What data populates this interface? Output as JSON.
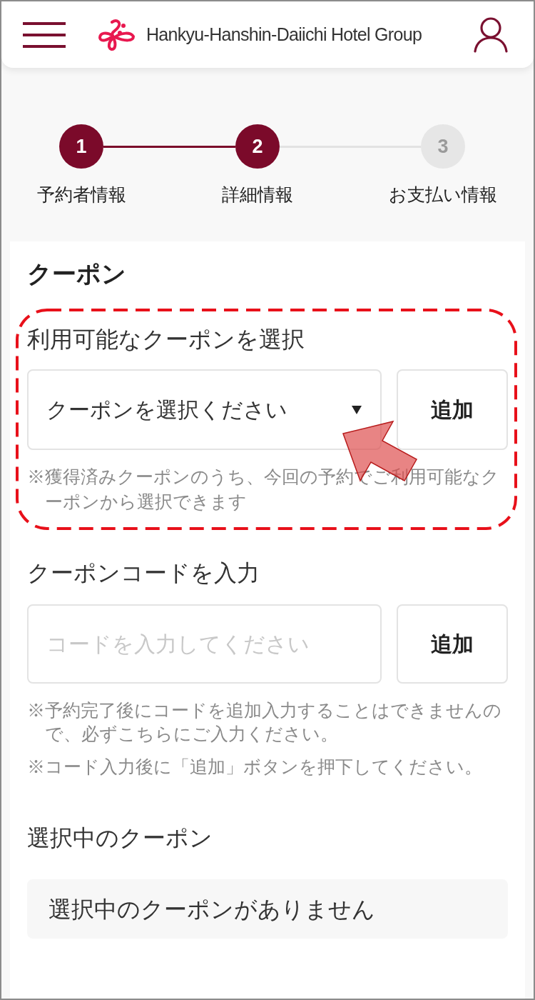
{
  "header": {
    "brand": "Hankyu-Hanshin-Daiichi Hotel Group"
  },
  "steps": [
    {
      "number": "1",
      "label": "予約者情報",
      "reached": true
    },
    {
      "number": "2",
      "label": "詳細情報",
      "reached": true
    },
    {
      "number": "3",
      "label": "お支払い情報",
      "reached": false
    }
  ],
  "coupon": {
    "title": "クーポン",
    "select_section": {
      "label": "利用可能なクーポンを選択",
      "select": {
        "value": "クーポンを選択ください"
      },
      "add_button": "追加",
      "note": "※獲得済みクーポンのうち、今回の予約でご利用可能なクーポンから選択できます"
    },
    "code_section": {
      "label": "クーポンコードを入力",
      "input": {
        "placeholder": "コードを入力してください"
      },
      "add_button": "追加",
      "notes": [
        "※予約完了後にコードを追加入力することはできませんので、必ずこちらにご入力ください。",
        "※コード入力後に「追加」ボタンを押下してください。"
      ]
    },
    "selected_section": {
      "label": "選択中のクーポン",
      "empty_message": "選択中のクーポンがありません"
    }
  }
}
